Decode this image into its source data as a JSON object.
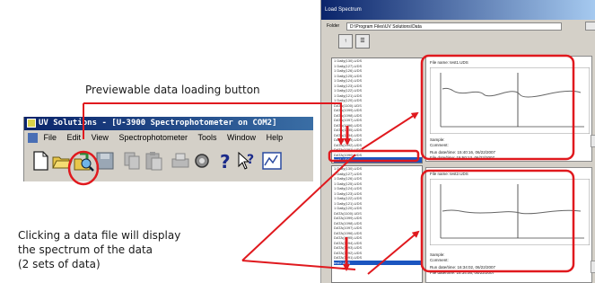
{
  "callouts": {
    "load_button": "Previewable data loading button",
    "click_line1": "Clicking a data file will display",
    "click_line2": "the spectrum of the data",
    "click_line3": "(2 sets of data)"
  },
  "app": {
    "title": "UV Solutions - [U-3900 Spectrophotometer on COM2]",
    "menu": [
      "File",
      "Edit",
      "View",
      "Spectrophotometer",
      "Tools",
      "Window",
      "Help"
    ]
  },
  "dialog": {
    "title": "Load Spectrum",
    "folder_label": "Folder",
    "folder_path": "D:\\Program Files\\UV Solutions\\Data",
    "list1": [
      "1 Daily(130).UDS",
      "1 Daily(127).UDS",
      "1 Daily(126).UDS",
      "1 Daily(125).UDS",
      "1 Daily(124).UDS",
      "1 Daily(123).UDS",
      "1 Daily(122).UDS",
      "1 Daily(121).UDS",
      "1 Daily(120).UDS",
      "DATA(1100).UDS",
      "DATA(1099).UDS",
      "DATA(1098).UDS",
      "DATA(1097).UDS",
      "DATA(1096).UDS",
      "DATA(1095).UDS",
      "DATA(1094).UDS",
      "DATA(1093).UDS",
      "DATA(1092).UDS",
      "DATA(1091).UDS",
      "DATA(1090).UDS"
    ],
    "list1_selected": "test1.UDS",
    "list2": [
      "1 Daily(130).UDS",
      "1 Daily(127).UDS",
      "1 Daily(126).UDS",
      "1 Daily(125).UDS",
      "1 Daily(124).UDS",
      "1 Daily(123).UDS",
      "1 Daily(122).UDS",
      "1 Daily(121).UDS",
      "1 Daily(120).UDS",
      "DATA(1100).UDS",
      "DATA(1099).UDS",
      "DATA(1098).UDS",
      "DATA(1097).UDS",
      "DATA(1096).UDS",
      "DATA(1095).UDS",
      "DATA(1094).UDS",
      "DATA(1093).UDS",
      "DATA(1092).UDS",
      "DATA(1091).UDS"
    ],
    "list2_selected": "test2.UDS",
    "panel1": {
      "file_name": "File name: test1.UDS",
      "sample": "Sample:",
      "comment": "Comment:",
      "run_date": "Run date/time: 15:40:16, 06/22/2007",
      "file_date": "File date/time: 15:50:13, 06/22/2007"
    },
    "panel2": {
      "file_name": "File name: test2.UDS",
      "sample": "Sample:",
      "comment": "Comment:",
      "run_date": "Run date/time: 16:34:02, 06/22/2007",
      "file_date": "File date/time: 16:34:56, 06/22/2007"
    }
  },
  "colors": {
    "callout_red": "#e0191e",
    "title_blue": "#0a246a",
    "selection_blue": "#1b55c0"
  },
  "icons": [
    "new-file-icon",
    "open-folder-icon",
    "load-preview-icon",
    "save-icon",
    "copy-icon",
    "paste-icon",
    "print-icon",
    "settings-icon",
    "help-icon",
    "whats-this-icon",
    "spectrum-view-icon"
  ]
}
